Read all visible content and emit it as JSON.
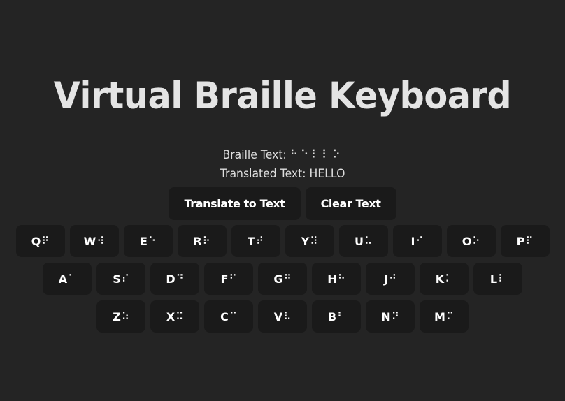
{
  "title": "Virtual Braille Keyboard",
  "braille_text": {
    "label": "Braille Text:",
    "value": "⠓⠑⠇⠇⠕"
  },
  "translated_text": {
    "label": "Translated Text:",
    "value": "HELLO"
  },
  "controls": {
    "translate_label": "Translate to Text",
    "clear_label": "Clear Text"
  },
  "keyboard": {
    "rows": [
      [
        {
          "letter": "Q",
          "braille": "⠟"
        },
        {
          "letter": "W",
          "braille": "⠺"
        },
        {
          "letter": "E",
          "braille": "⠑"
        },
        {
          "letter": "R",
          "braille": "⠗"
        },
        {
          "letter": "T",
          "braille": "⠞"
        },
        {
          "letter": "Y",
          "braille": "⠽"
        },
        {
          "letter": "U",
          "braille": "⠥"
        },
        {
          "letter": "I",
          "braille": "⠊"
        },
        {
          "letter": "O",
          "braille": "⠕"
        },
        {
          "letter": "P",
          "braille": "⠏"
        }
      ],
      [
        {
          "letter": "A",
          "braille": "⠁"
        },
        {
          "letter": "S",
          "braille": "⠎"
        },
        {
          "letter": "D",
          "braille": "⠙"
        },
        {
          "letter": "F",
          "braille": "⠋"
        },
        {
          "letter": "G",
          "braille": "⠛"
        },
        {
          "letter": "H",
          "braille": "⠓"
        },
        {
          "letter": "J",
          "braille": "⠚"
        },
        {
          "letter": "K",
          "braille": "⠅"
        },
        {
          "letter": "L",
          "braille": "⠇"
        }
      ],
      [
        {
          "letter": "Z",
          "braille": "⠵"
        },
        {
          "letter": "X",
          "braille": "⠭"
        },
        {
          "letter": "C",
          "braille": "⠉"
        },
        {
          "letter": "V",
          "braille": "⠧"
        },
        {
          "letter": "B",
          "braille": "⠃"
        },
        {
          "letter": "N",
          "braille": "⠝"
        },
        {
          "letter": "M",
          "braille": "⠍"
        }
      ]
    ]
  },
  "colors": {
    "background": "#242424",
    "key_background": "#1a1a1a",
    "text": "#ffffff",
    "title": "#e4e4e4"
  }
}
